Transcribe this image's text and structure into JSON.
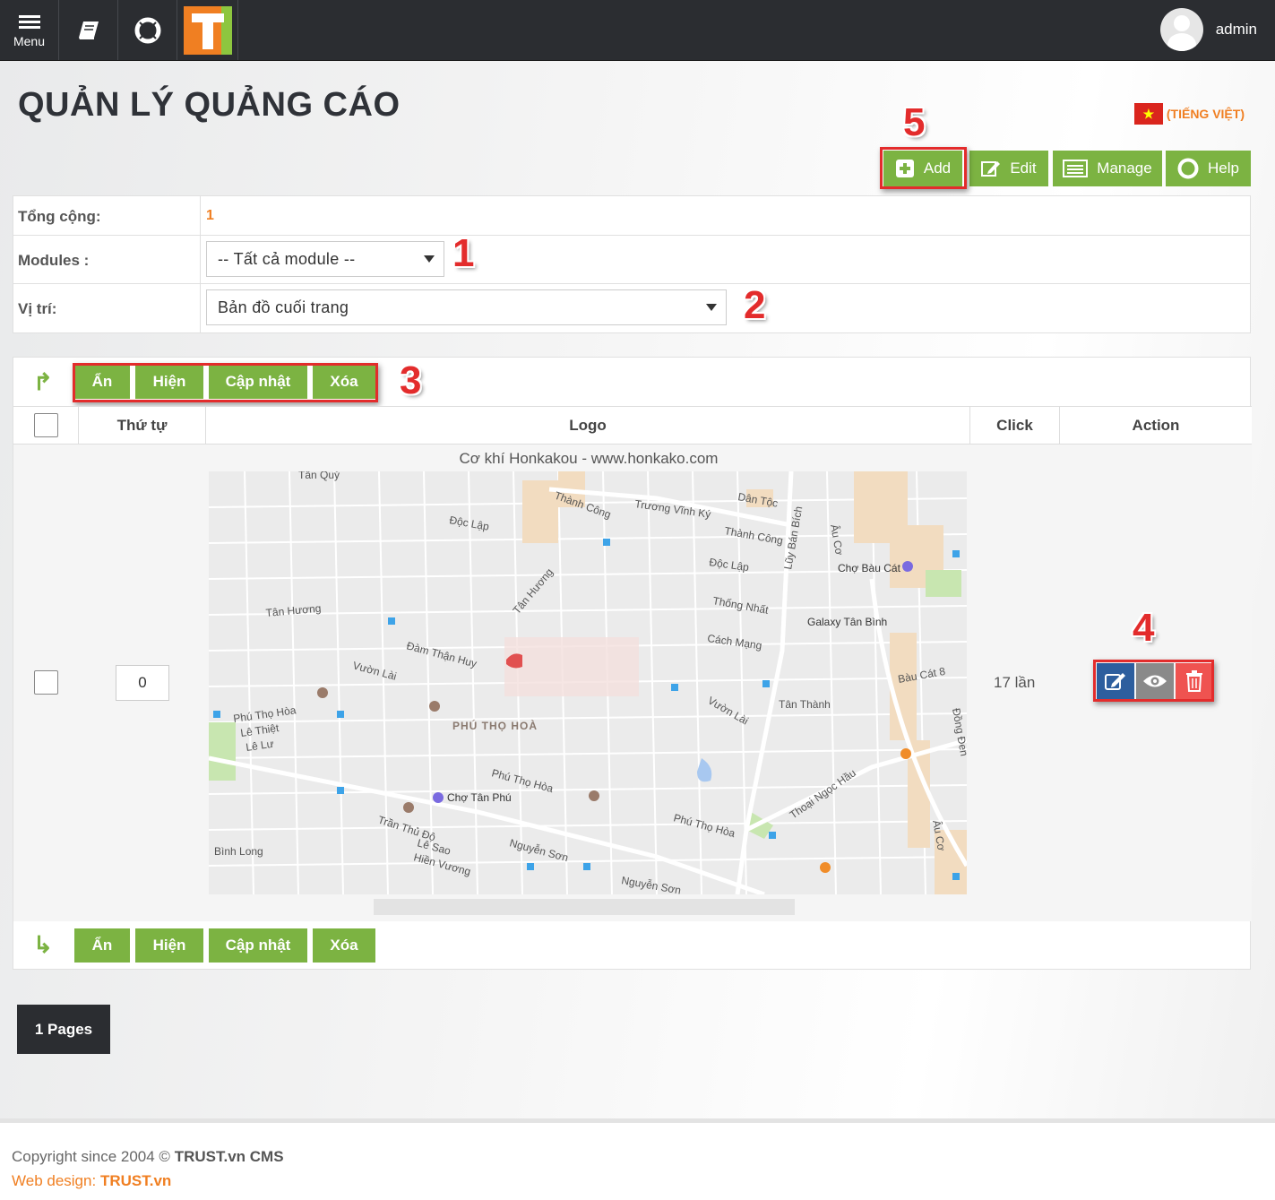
{
  "topbar": {
    "menu_label": "Menu",
    "user_name": "admin",
    "icons": [
      "hamburger-icon",
      "book-icon",
      "lifebuoy-icon",
      "trust-logo"
    ]
  },
  "page": {
    "title": "QUẢN LÝ QUẢNG CÁO",
    "language": "(TIẾNG VIỆT)"
  },
  "toolbar": {
    "add": "Add",
    "edit": "Edit",
    "manage": "Manage",
    "help": "Help"
  },
  "filter": {
    "total_label": "Tổng cộng:",
    "total_value": "1",
    "modules_label": "Modules :",
    "modules_value": "-- Tất cả module --",
    "position_label": "Vị trí:",
    "position_value": "Bản đồ cuối trang"
  },
  "actions": {
    "hide": "Ẩn",
    "show": "Hiện",
    "update": "Cập nhật",
    "delete": "Xóa"
  },
  "table": {
    "headers": {
      "order": "Thứ tự",
      "logo": "Logo",
      "click": "Click",
      "action": "Action"
    },
    "rows": [
      {
        "order": "0",
        "logo_caption": "Cơ khí Honkakou - www.honkako.com",
        "clicks": "17 lần"
      }
    ]
  },
  "map_labels": {
    "l1": "Tân Quý",
    "l2": "Thành Công",
    "l3": "Trương Vĩnh Ký",
    "l4": "Dân Tộc",
    "l5": "Độc Lập",
    "l6": "Thành Công",
    "l7": "Độc Lập",
    "l8": "Chợ Bàu Cát",
    "l9": "Tân Hương",
    "l10": "Thống Nhất",
    "l11": "Galaxy Tân Bình",
    "l12": "Tân Hương",
    "l13": "Đàm Thận Huy",
    "l14": "Cách Mạng",
    "l15": "Vườn Lài",
    "l16": "Bàu Cát 8",
    "l17": "Phú Thọ Hòa",
    "l18": "PHÚ THỌ HOÀ",
    "l19": "Tân Thành",
    "l20": "Vườn Lài",
    "l21": "Lê Thiệt",
    "l22": "Lê Lư",
    "l23": "Phú Thọ Hòa",
    "l24": "Chợ Tân Phú",
    "l25": "Thoại Ngọc Hầu",
    "l26": "Phú Thọ Hòa",
    "l27": "Trần Thủ Độ",
    "l28": "Lê Sao",
    "l29": "Bình Long",
    "l30": "Hiền Vương",
    "l31": "Nguyễn Sơn",
    "l32": "Nguyễn Sơn",
    "l33": "Lũy Bán Bích",
    "l34": "Âu Cơ",
    "l35": "Âu Cơ",
    "l36": "Đồng Đen"
  },
  "pagination": {
    "label": "1 Pages"
  },
  "footer": {
    "copyright_prefix": "Copyright since 2004 ©",
    "copyright_brand": "TRUST.vn CMS",
    "design_prefix": "Web design:",
    "design_brand": "TRUST.vn"
  },
  "annotations": [
    "1",
    "2",
    "3",
    "4",
    "5"
  ],
  "colors": {
    "topbar": "#2b2d31",
    "green_button": "#7cb342",
    "annotation_red": "#e32c2c",
    "accent_orange": "#f07f22",
    "edit_blue": "#2d5e9e",
    "view_gray": "#8a8a8a",
    "delete_red": "#ef5350"
  }
}
